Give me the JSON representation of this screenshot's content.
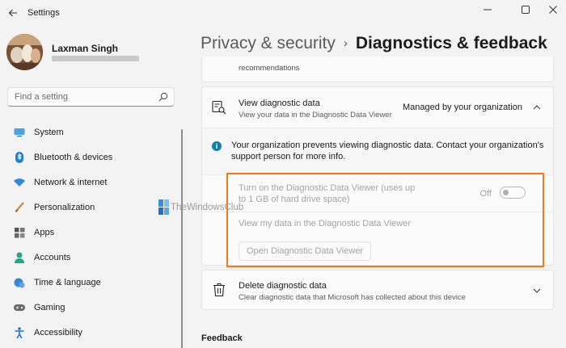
{
  "window": {
    "app_title": "Settings",
    "buttons": [
      "minimize",
      "maximize",
      "close"
    ]
  },
  "user": {
    "name": "Laxman Singh"
  },
  "search": {
    "placeholder": "Find a setting"
  },
  "nav": {
    "items": [
      {
        "label": "System",
        "icon": "monitor-icon"
      },
      {
        "label": "Bluetooth & devices",
        "icon": "bluetooth-icon"
      },
      {
        "label": "Network & internet",
        "icon": "wifi-icon"
      },
      {
        "label": "Personalization",
        "icon": "brush-icon"
      },
      {
        "label": "Apps",
        "icon": "apps-icon"
      },
      {
        "label": "Accounts",
        "icon": "person-icon"
      },
      {
        "label": "Time & language",
        "icon": "globe-clock-icon"
      },
      {
        "label": "Gaming",
        "icon": "gamepad-icon"
      },
      {
        "label": "Accessibility",
        "icon": "accessibility-icon"
      }
    ]
  },
  "breadcrumb": {
    "parent": "Privacy & security",
    "separator": "›",
    "current": "Diagnostics & feedback"
  },
  "top_panel": {
    "text": "recommendations"
  },
  "view_diagnostic": {
    "title": "View diagnostic data",
    "description": "View your data in the Diagnostic Data Viewer",
    "status": "Managed by your organization",
    "info": "Your organization prevents viewing diagnostic data. Contact your organization's support person for more info.",
    "toggle_label": "Turn on the Diagnostic Data Viewer (uses up to 1 GB of hard drive space)",
    "toggle_state": "Off",
    "view_label": "View my data in the Diagnostic Data Viewer",
    "open_button": "Open Diagnostic Data Viewer"
  },
  "watermark": {
    "text": "TheWindowsClub"
  },
  "delete_diagnostic": {
    "title": "Delete diagnostic data",
    "description": "Clear diagnostic data that Microsoft has collected about this device"
  },
  "feedback": {
    "heading": "Feedback"
  },
  "colors": {
    "accent": "#0067c0",
    "highlight_border": "#f07a1f",
    "info": "#0f7fa8"
  }
}
